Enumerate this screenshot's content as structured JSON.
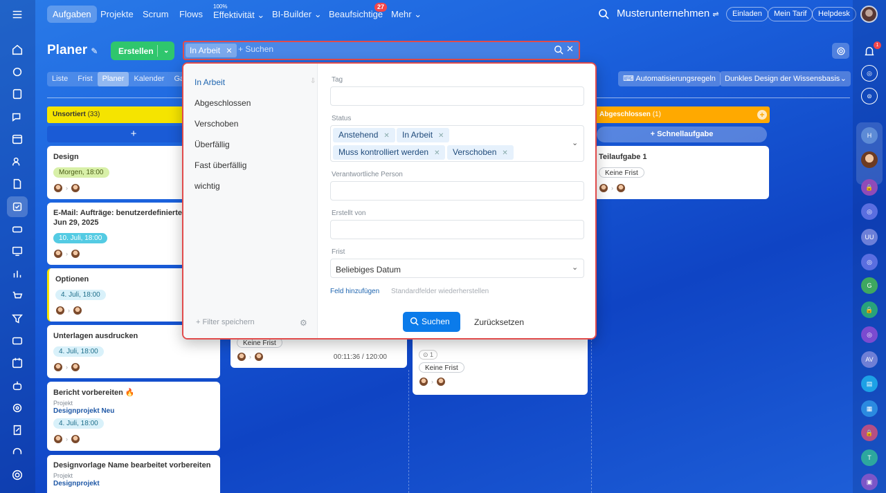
{
  "topnav": {
    "tabs": [
      "Aufgaben",
      "Projekte",
      "Scrum",
      "Flows",
      "Effektivität",
      "BI-Builder",
      "Beaufsichtige",
      "Mehr"
    ],
    "efficiency_value": "100%",
    "watch_badge": "27",
    "company": "Musterunternehmen",
    "buttons": [
      "Einladen",
      "Mein Tarif",
      "Helpdesk"
    ]
  },
  "header": {
    "title": "Planer",
    "create_label": "Erstellen"
  },
  "filterbar": {
    "tag": "In Arbeit",
    "placeholder": "+ Suchen"
  },
  "viewtabs": [
    "Liste",
    "Frist",
    "Planer",
    "Kalender",
    "Ga"
  ],
  "toolbar": {
    "automation": "Automatisierungsregeln",
    "theme": "Dunkles Design der Wissensbasis"
  },
  "columns": {
    "unsorted": {
      "title": "Unsortiert",
      "count": "(33)",
      "color": "#f5e400",
      "add": "+"
    },
    "done": {
      "title": "Abgeschlossen",
      "count": "(1)",
      "color": "#ffa900",
      "quick": "+ Schnellaufgabe"
    }
  },
  "cards": [
    {
      "title": "Design",
      "deadline": "Morgen, 18:00",
      "deadline_color": "#d8f0a8"
    },
    {
      "title": "E-Mail: Aufträge: benutzerdefinierte Felder - Jun 29, 2025",
      "deadline": "10. Juli, 18:00",
      "deadline_color": "#54cbe3"
    },
    {
      "title": "Optionen",
      "deadline": "4. Juli, 18:00",
      "deadline_color": "#d9f1fa"
    },
    {
      "title": "Unterlagen ausdrucken",
      "deadline": "4. Juli, 18:00",
      "deadline_color": "#d9f1fa"
    },
    {
      "title": "Bericht vorbereiten 🔥",
      "project_label": "Projekt",
      "project": "Designprojekt Neu",
      "deadline": "4. Juli, 18:00",
      "deadline_color": "#d9f1fa"
    },
    {
      "title": "Designvorlage Name bearbeitet vorbereiten",
      "project_label": "Projekt",
      "project": "Designprojekt"
    }
  ],
  "col2_card": {
    "badge": "Keine Frist",
    "timer": "00:11:36 / 120:00"
  },
  "col3_card": {
    "counter": "1",
    "badge": "Keine Frist"
  },
  "done_card": {
    "title": "Teilaufgabe 1",
    "badge": "Keine Frist"
  },
  "popup": {
    "presets": [
      "In Arbeit",
      "Abgeschlossen",
      "Verschoben",
      "Überfällig",
      "Fast überfällig",
      "wichtig"
    ],
    "save_filter": "+ Filter speichern",
    "fields": {
      "tag": "Tag",
      "status": "Status",
      "responsible": "Verantwortliche Person",
      "created_by": "Erstellt von",
      "deadline": "Frist"
    },
    "status_values": [
      "Anstehend",
      "In Arbeit",
      "Muss kontrolliert werden",
      "Verschoben"
    ],
    "deadline_value": "Beliebiges Datum",
    "add_field": "Feld hinzufügen",
    "restore_fields": "Standardfelder wiederherstellen",
    "search_btn": "Suchen",
    "reset_btn": "Zurücksetzen"
  },
  "rightbar": {
    "notification_badge": "1",
    "initials": [
      "H",
      "UU",
      "G",
      "AV",
      "T"
    ]
  },
  "colors": {
    "accent": "#2066b0",
    "create": "#2fc66d",
    "search_btn": "#0b7bea",
    "highlight": "#e14b4b"
  }
}
